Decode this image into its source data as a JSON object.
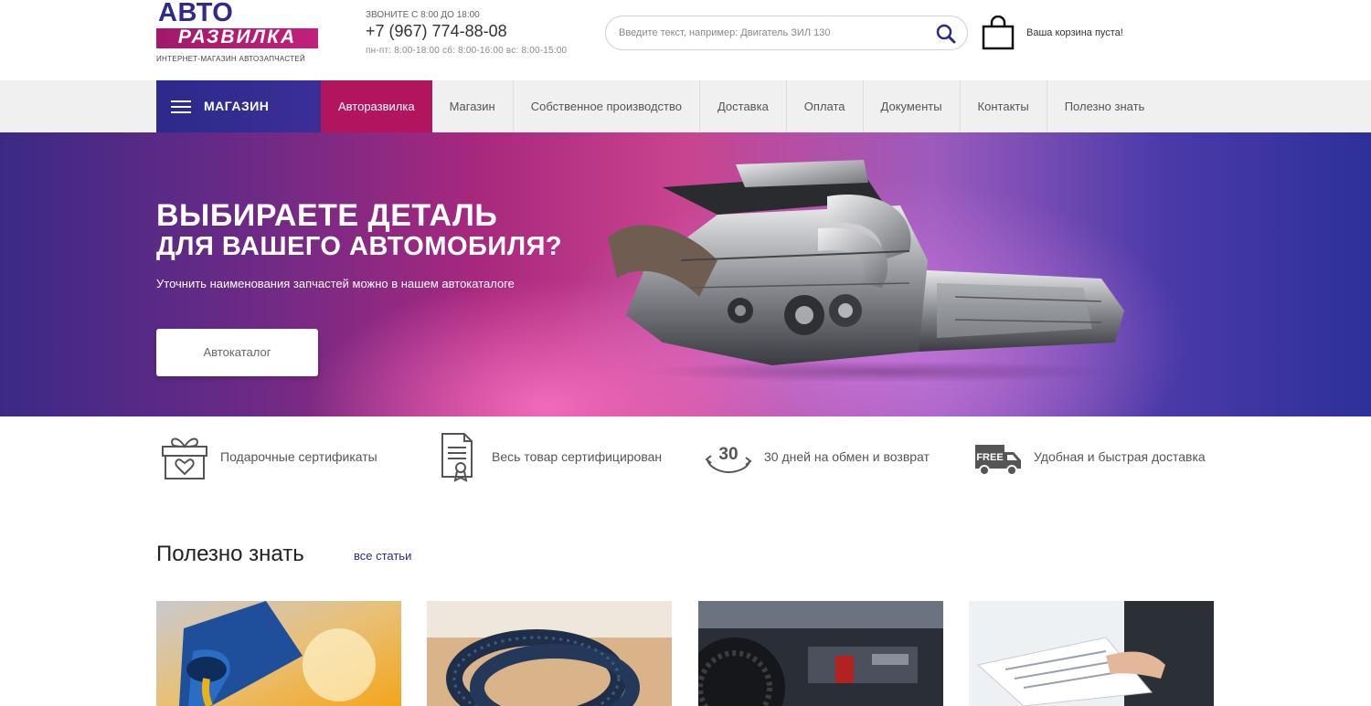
{
  "logo": {
    "top_text": "АВТО",
    "mid_text": "РАЗВИЛКА",
    "sub_text": "ИНТЕРНЕТ-МАГАЗИН АВТОЗАПЧАСТЕЙ"
  },
  "contacts": {
    "call_label": "ЗВОНИТЕ С 8:00 ДО 18:00",
    "phone": "+7 (967) 774-88-08",
    "hours": "пн-пт: 8:00-18:00 сб: 8:00-16:00 вс: 8:00-15:00"
  },
  "search": {
    "placeholder": "Введите текст, например: Двигатель ЗИЛ 130"
  },
  "cart": {
    "status": "Ваша корзина пуста!"
  },
  "nav": {
    "shop_label": "МАГАЗИН",
    "items": [
      {
        "label": "Авторазвилка",
        "active": true
      },
      {
        "label": "Магазин"
      },
      {
        "label": "Собственное производство"
      },
      {
        "label": "Доставка"
      },
      {
        "label": "Оплата"
      },
      {
        "label": "Документы"
      },
      {
        "label": "Контакты"
      },
      {
        "label": "Полезно знать"
      }
    ]
  },
  "banner": {
    "title_line1": "ВЫБИРАЕТЕ ДЕТАЛЬ",
    "title_line2": "ДЛЯ ВАШЕГО АВТОМОБИЛЯ?",
    "subtitle": "Уточнить наименования запчастей можно в нашем автокаталоге",
    "button": "Автокаталог"
  },
  "features": [
    {
      "label": "Подарочные сертификаты",
      "icon": "gift-icon"
    },
    {
      "label": "Весь товар сертифицирован",
      "icon": "certificate-icon"
    },
    {
      "label": "30 дней на обмен и возврат",
      "icon": "return-30-icon",
      "badge": "30"
    },
    {
      "label": "Удобная и быстрая доставка",
      "icon": "free-truck-icon",
      "badge": "FREE"
    }
  ],
  "useful": {
    "title": "Полезно знать",
    "all_link": "все статьи"
  },
  "colors": {
    "brand_blue": "#2c2a8b",
    "brand_magenta": "#b2145e"
  }
}
